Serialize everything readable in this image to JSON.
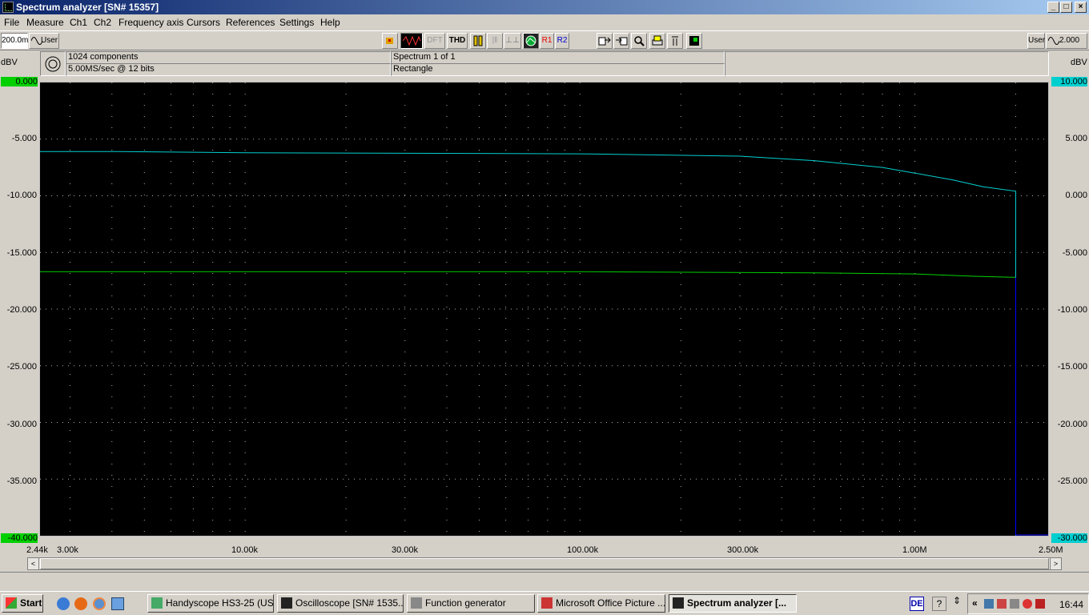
{
  "window": {
    "title": "Spectrum analyzer  [SN# 15357]"
  },
  "menu": [
    "File",
    "Measure",
    "Ch1",
    "Ch2",
    "Frequency axis",
    "Cursors",
    "References",
    "Settings",
    "Help"
  ],
  "toolbar": {
    "left_range": "200.0m",
    "left_mode": "User",
    "dft": "DFT",
    "thd": "THD",
    "r1": "R1",
    "r2": "R2",
    "right_mode": "User",
    "right_range": "2.000"
  },
  "info": {
    "components": "1024 components",
    "sample_rate": "5.00MS/sec @ 12 bits",
    "spectrum": "Spectrum 1 of 1",
    "window": "Rectangle"
  },
  "axes": {
    "left_unit": "dBV",
    "right_unit": "dBV",
    "left_ticks": [
      "0.000",
      "-5.000",
      "-10.000",
      "-15.000",
      "-20.000",
      "-25.000",
      "-30.000",
      "-35.000",
      "-40.000"
    ],
    "right_ticks": [
      "10.000",
      "5.000",
      "0.000",
      "-5.000",
      "-10.000",
      "-15.000",
      "-20.000",
      "-25.000",
      "-30.000"
    ],
    "x_ticks": [
      "2.44k",
      "3.00k",
      "10.00k",
      "30.00k",
      "100.00k",
      "300.00k",
      "1.00M",
      "2.50M"
    ]
  },
  "colors": {
    "ch1": "#00d000",
    "ch2": "#00cfd0",
    "marker": "#0000ff",
    "plot_bg": "#000000",
    "grid": "#b0b0b0"
  },
  "chart_data": {
    "type": "line",
    "x_scale": "log",
    "xlim": [
      2440,
      2500000
    ],
    "series": [
      {
        "y_axis": "left",
        "unit": "dBV",
        "color": "#00d000",
        "x": [
          2440,
          100000,
          500000,
          1000000,
          1500000,
          2000000
        ],
        "y": [
          -16.7,
          -16.7,
          -16.8,
          -16.9,
          -17.1,
          -17.2
        ]
      },
      {
        "y_axis": "right",
        "unit": "dBV",
        "color": "#00cfd0",
        "x": [
          2440,
          4200,
          10000,
          100000,
          300000,
          500000,
          800000,
          1000000,
          1300000,
          1600000,
          2000000
        ],
        "y": [
          3.9,
          3.9,
          3.8,
          3.7,
          3.5,
          3.1,
          2.5,
          2.0,
          1.4,
          0.8,
          0.4
        ]
      }
    ],
    "left_ylim": [
      -40,
      0
    ],
    "right_ylim": [
      -30,
      10
    ],
    "grid": true
  },
  "taskbar": {
    "start": "Start",
    "tasks": [
      "Handyscope HS3-25 (US...",
      "Oscilloscope  [SN# 1535...",
      "Function generator",
      "Microsoft Office Picture ...",
      "Spectrum analyzer  [..."
    ],
    "lang": "DE",
    "clock": "16:44"
  }
}
